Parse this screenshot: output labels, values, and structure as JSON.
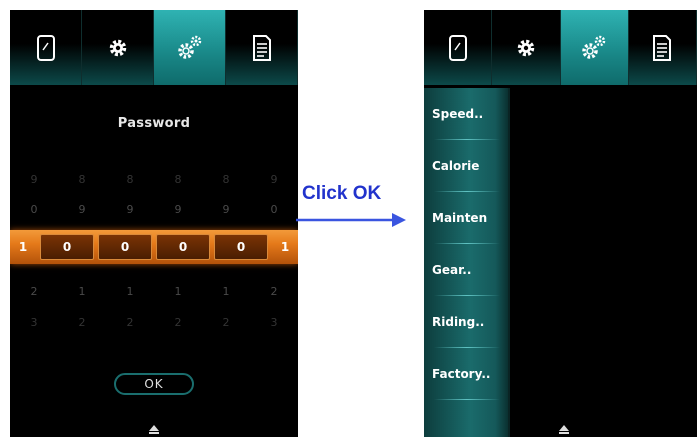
{
  "left_screen": {
    "tabs": [
      {
        "icon": "phone-icon"
      },
      {
        "icon": "gear-icon"
      },
      {
        "icon": "gears-icon",
        "active": true
      },
      {
        "icon": "document-icon"
      }
    ],
    "title": "Password",
    "rows_above_2": [
      "9",
      "8",
      "8",
      "8",
      "8",
      "9"
    ],
    "rows_above_1": [
      "0",
      "9",
      "9",
      "9",
      "9",
      "0"
    ],
    "selected": [
      "1",
      "0",
      "0",
      "0",
      "0",
      "1"
    ],
    "rows_below_1": [
      "2",
      "1",
      "1",
      "1",
      "1",
      "2"
    ],
    "rows_below_2": [
      "3",
      "2",
      "2",
      "2",
      "2",
      "3"
    ],
    "ok_label": "OK"
  },
  "annotation": {
    "label": "Click OK",
    "color": "#2233cc"
  },
  "right_screen": {
    "tabs": [
      {
        "icon": "phone-icon"
      },
      {
        "icon": "gear-icon"
      },
      {
        "icon": "gears-icon",
        "active": true
      },
      {
        "icon": "document-icon"
      }
    ],
    "menu": [
      "Speed..",
      "Calorie",
      "Mainten",
      "Gear..",
      "Riding..",
      "Factory.."
    ]
  },
  "colors": {
    "accent_teal": "#1a8a8a",
    "selection_orange": "#e57a1a"
  }
}
